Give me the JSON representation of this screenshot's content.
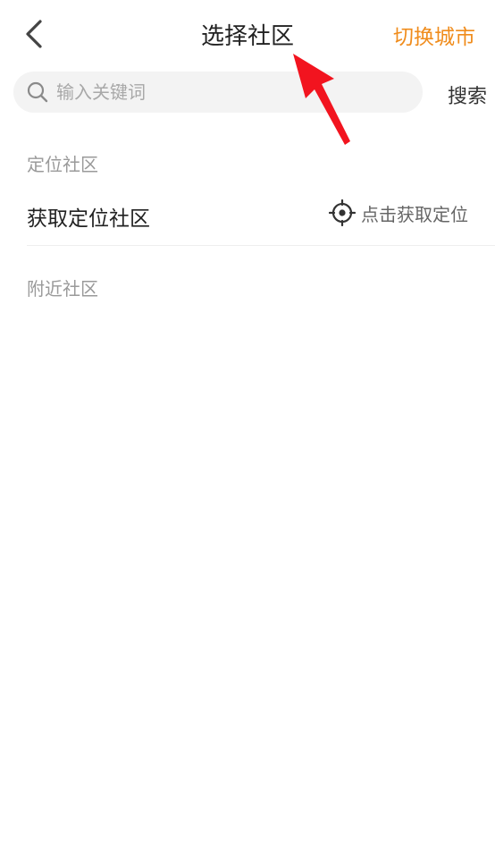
{
  "header": {
    "title": "选择社区",
    "switch_city_label": "切换城市"
  },
  "search": {
    "placeholder": "输入关键词",
    "button_label": "搜索"
  },
  "locate_section": {
    "header": "定位社区",
    "row_label": "获取定位社区",
    "action_label": "点击获取定位"
  },
  "nearby_section": {
    "header": "附近社区"
  },
  "colors": {
    "accent": "#f08c1c",
    "annotation_arrow": "#f2141f"
  },
  "icons": {
    "back": "chevron-left-icon",
    "search": "search-icon",
    "locate": "crosshair-icon"
  }
}
